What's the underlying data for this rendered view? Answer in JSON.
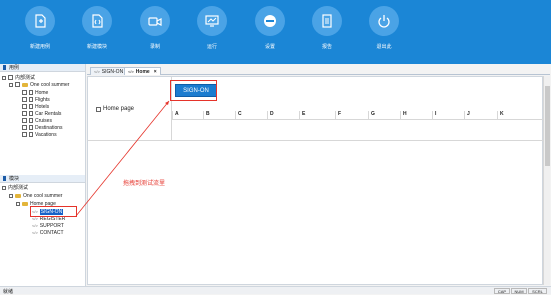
{
  "toolbar": {
    "items": [
      {
        "label": "新建用例",
        "icon": "new-case-icon"
      },
      {
        "label": "新建模块",
        "icon": "new-module-icon"
      },
      {
        "label": "录制",
        "icon": "record-icon"
      },
      {
        "label": "运行",
        "icon": "run-icon"
      },
      {
        "label": "设置",
        "icon": "settings-icon"
      },
      {
        "label": "报告",
        "icon": "report-icon"
      },
      {
        "label": "退出此",
        "icon": "exit-icon"
      }
    ]
  },
  "left_top": {
    "header": "用例",
    "tree": [
      "内部测试",
      "One cool summer",
      "Home",
      "Flights",
      "Hotels",
      "Car Rentals",
      "Cruises",
      "Destinations",
      "Vacations"
    ]
  },
  "left_bottom": {
    "header": "模块",
    "tree": [
      "内部测试",
      "One cool summer",
      "Home page",
      "SIGN-ON",
      "REGISTER",
      "SUPPORT",
      "CONTACT"
    ]
  },
  "tabs": [
    {
      "label": "SIGN-ON"
    },
    {
      "label": "Home",
      "close": "×"
    }
  ],
  "content": {
    "home_label": "Home page",
    "signon_button": "SIGN-ON",
    "columns": [
      "A",
      "B",
      "C",
      "D",
      "E",
      "F",
      "G",
      "H",
      "I",
      "J",
      "K"
    ],
    "annotation": "拖拽到测试流里"
  },
  "status": {
    "left": "就绪",
    "indicators": [
      "CAP",
      "NUM",
      "SCRL"
    ]
  },
  "colors": {
    "toolbar": "#1b86d6",
    "highlight": "#e5332a",
    "button": "#1b7ccf"
  }
}
